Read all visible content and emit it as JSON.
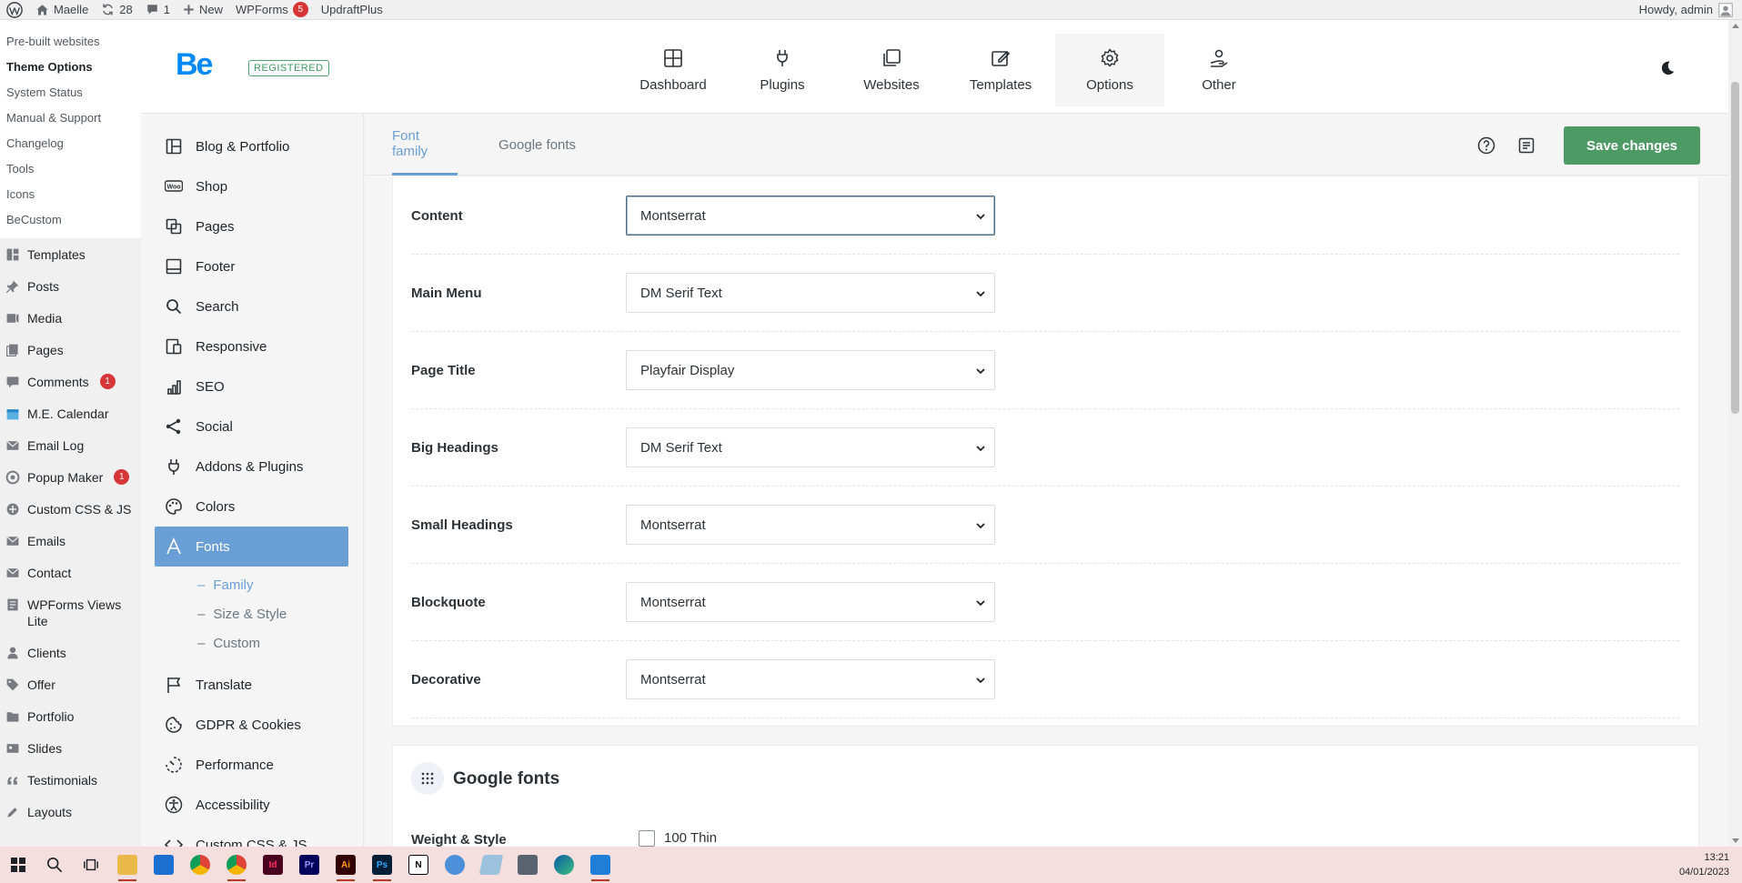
{
  "adminbar": {
    "site_name": "Maelle",
    "updates_count": "28",
    "comments_count": "1",
    "new_label": "New",
    "wpforms_label": "WPForms",
    "wpforms_count": "5",
    "updraft_label": "UpdraftPlus",
    "howdy": "Howdy, admin"
  },
  "wpmenu": {
    "submenu": [
      "Pre-built websites",
      "Theme Options",
      "System Status",
      "Manual & Support",
      "Changelog",
      "Tools",
      "Icons",
      "BeCustom"
    ],
    "items": [
      {
        "label": "Templates",
        "icon": "templates-icon"
      },
      {
        "label": "Posts",
        "icon": "pin-icon"
      },
      {
        "label": "Media",
        "icon": "media-icon"
      },
      {
        "label": "Pages",
        "icon": "pages-icon"
      },
      {
        "label": "Comments",
        "icon": "comment-icon",
        "badge": "1"
      },
      {
        "label": "M.E. Calendar",
        "icon": "calendar-icon"
      },
      {
        "label": "Email Log",
        "icon": "mail-icon"
      },
      {
        "label": "Popup Maker",
        "icon": "popup-icon",
        "badge": "1"
      },
      {
        "label": "Custom CSS & JS",
        "icon": "plus-circle-icon"
      },
      {
        "label": "Emails",
        "icon": "mail-icon"
      },
      {
        "label": "Contact",
        "icon": "mail-icon"
      },
      {
        "label": "WPForms Views Lite",
        "icon": "forms-icon"
      },
      {
        "label": "Clients",
        "icon": "user-icon"
      },
      {
        "label": "Offer",
        "icon": "tag-icon"
      },
      {
        "label": "Portfolio",
        "icon": "folder-icon"
      },
      {
        "label": "Slides",
        "icon": "slides-icon"
      },
      {
        "label": "Testimonials",
        "icon": "quote-icon"
      },
      {
        "label": "Layouts",
        "icon": "pencil-icon"
      }
    ]
  },
  "header": {
    "logo": "Be",
    "registered": "REGISTERED",
    "tabs": [
      {
        "label": "Dashboard",
        "icon": "dashboard-icon"
      },
      {
        "label": "Plugins",
        "icon": "plug-icon"
      },
      {
        "label": "Websites",
        "icon": "websites-icon"
      },
      {
        "label": "Templates",
        "icon": "templates-edit-icon"
      },
      {
        "label": "Options",
        "icon": "gear-icon"
      },
      {
        "label": "Other",
        "icon": "hand-user-icon"
      }
    ]
  },
  "be_sidebar": {
    "items": [
      {
        "label": "Blog & Portfolio",
        "icon": "layout-icon"
      },
      {
        "label": "Shop",
        "icon": "woo-icon"
      },
      {
        "label": "Pages",
        "icon": "pages-copy-icon"
      },
      {
        "label": "Footer",
        "icon": "footer-icon"
      },
      {
        "label": "Search",
        "icon": "search-icon"
      },
      {
        "label": "Responsive",
        "icon": "responsive-icon"
      },
      {
        "label": "SEO",
        "icon": "bar-chart-icon"
      },
      {
        "label": "Social",
        "icon": "share-icon"
      },
      {
        "label": "Addons & Plugins",
        "icon": "plug-icon"
      },
      {
        "label": "Colors",
        "icon": "palette-icon"
      },
      {
        "label": "Fonts",
        "icon": "font-icon"
      }
    ],
    "font_sub": [
      "Family",
      "Size & Style",
      "Custom"
    ],
    "items_after": [
      {
        "label": "Translate",
        "icon": "flag-icon"
      },
      {
        "label": "GDPR & Cookies",
        "icon": "cookie-icon"
      },
      {
        "label": "Performance",
        "icon": "performance-icon"
      },
      {
        "label": "Accessibility",
        "icon": "accessibility-icon"
      },
      {
        "label": "Custom CSS & JS",
        "icon": "code-icon"
      }
    ]
  },
  "subnav": {
    "tab_family": "Font family",
    "tab_google": "Google fonts",
    "save": "Save changes"
  },
  "font_family": [
    {
      "label": "Content",
      "value": "Montserrat"
    },
    {
      "label": "Main Menu",
      "value": "DM Serif Text"
    },
    {
      "label": "Page Title",
      "value": "Playfair Display"
    },
    {
      "label": "Big Headings",
      "value": "DM Serif Text"
    },
    {
      "label": "Small Headings",
      "value": "Montserrat"
    },
    {
      "label": "Blockquote",
      "value": "Montserrat"
    },
    {
      "label": "Decorative",
      "value": "Montserrat"
    }
  ],
  "google_fonts": {
    "title": "Google fonts",
    "weight_label": "Weight & Style",
    "first_option": "100 Thin"
  },
  "taskbar": {
    "time": "13:21",
    "date": "04/01/2023"
  }
}
